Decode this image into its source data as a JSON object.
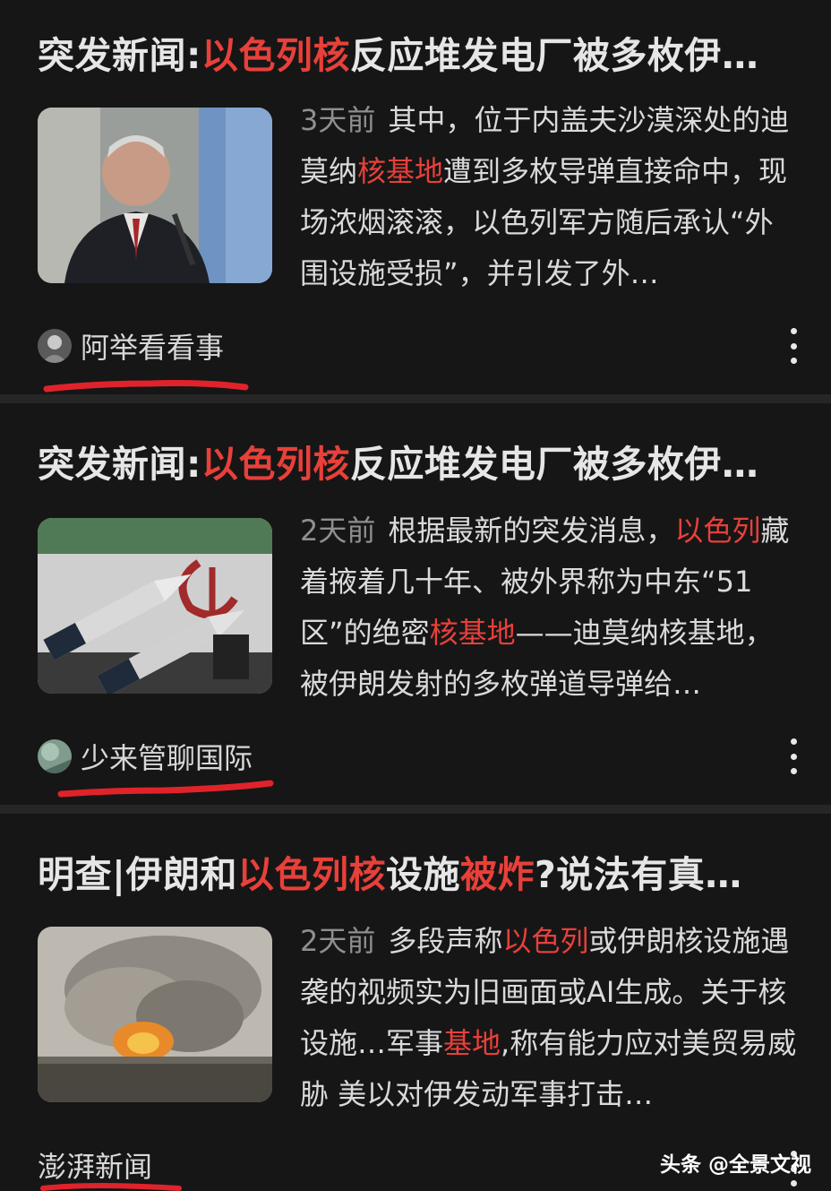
{
  "articles": [
    {
      "title_parts": [
        {
          "text": "突发新闻:",
          "hl": false
        },
        {
          "text": "以色列核",
          "hl": true
        },
        {
          "text": "反应堆发电厂被多枚伊…",
          "hl": false
        }
      ],
      "time": "3天前",
      "snippet_parts": [
        {
          "text": "其中，位于内盖夫沙漠深处的迪莫纳",
          "hl": false
        },
        {
          "text": "核基地",
          "hl": true
        },
        {
          "text": "遭到多枚导弹直接命中，现场浓烟滚滚，以色列军方随后承认“外围设施受损”，并引发了外…",
          "hl": false
        }
      ],
      "source": "阿举看看事",
      "thumb_icon": "news-photo-speaker"
    },
    {
      "title_parts": [
        {
          "text": "突发新闻:",
          "hl": false
        },
        {
          "text": "以色列核",
          "hl": true
        },
        {
          "text": "反应堆发电厂被多枚伊…",
          "hl": false
        }
      ],
      "time": "2天前",
      "snippet_parts": [
        {
          "text": "根据最新的突发消息，",
          "hl": false
        },
        {
          "text": "以色列",
          "hl": true
        },
        {
          "text": "藏着掖着几十年、被外界称为中东“51区”的绝密",
          "hl": false
        },
        {
          "text": "核基地",
          "hl": true
        },
        {
          "text": "——迪莫纳核基地，被伊朗发射的多枚弹道导弹给…",
          "hl": false
        }
      ],
      "source": "少来管聊国际",
      "thumb_icon": "missiles-photo"
    },
    {
      "title_parts": [
        {
          "text": "明查|伊朗和",
          "hl": false
        },
        {
          "text": "以色列核",
          "hl": true
        },
        {
          "text": "设施",
          "hl": false
        },
        {
          "text": "被炸",
          "hl": true
        },
        {
          "text": "?说法有真…",
          "hl": false
        }
      ],
      "time": "2天前",
      "snippet_parts": [
        {
          "text": "多段声称",
          "hl": false
        },
        {
          "text": "以色列",
          "hl": true
        },
        {
          "text": "或伊朗核设施遇袭的视频实为旧画面或AI生成。关于核设施…军事",
          "hl": false
        },
        {
          "text": "基地",
          "hl": true
        },
        {
          "text": ",称有能力应对美贸易威胁 美以对伊发动军事打击…",
          "hl": false
        }
      ],
      "source": "澎湃新闻",
      "thumb_icon": "explosion-photo"
    }
  ],
  "watermark": "头条 @全景文视",
  "colors": {
    "background": "#161616",
    "highlight": "#e8403a",
    "underline": "#e0232b",
    "separator": "#262626"
  }
}
